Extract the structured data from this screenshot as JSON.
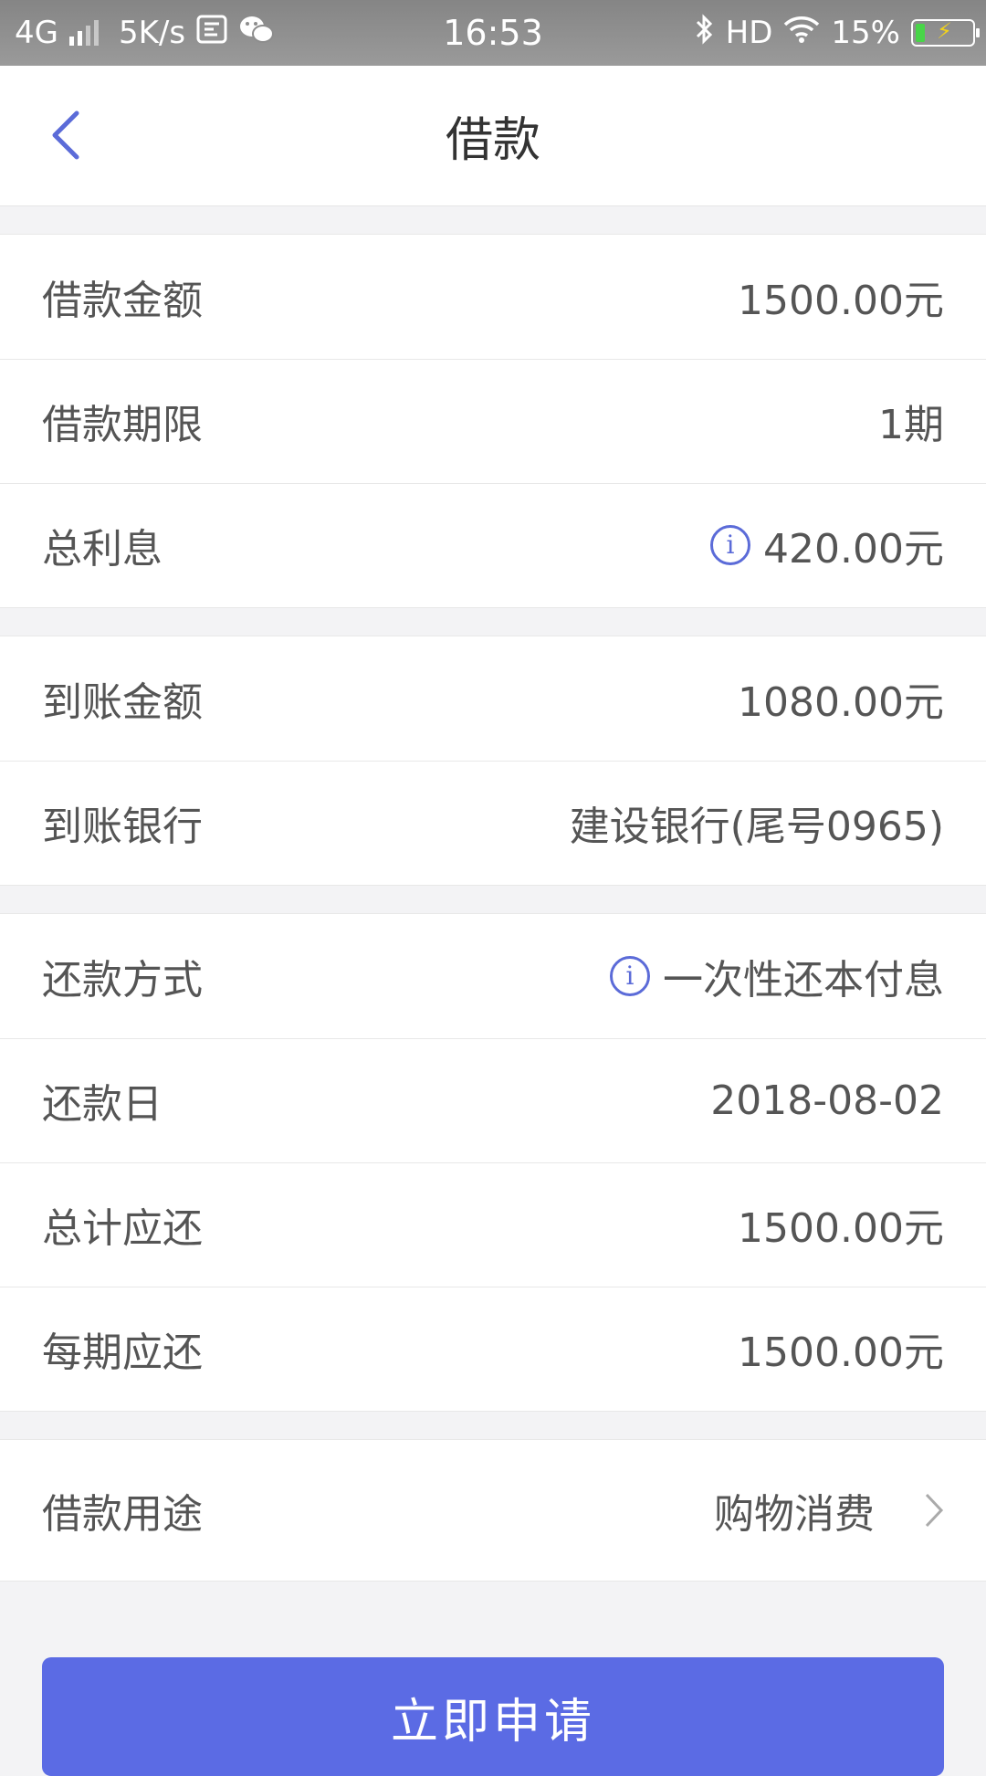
{
  "status_bar": {
    "network": "4G",
    "speed": "5K/s",
    "time": "16:53",
    "hd": "HD",
    "battery": "15%",
    "icons": [
      "signal-icon",
      "app-notification-icon",
      "wechat-icon",
      "bluetooth-icon",
      "wifi-icon",
      "battery-icon"
    ]
  },
  "header": {
    "title": "借款"
  },
  "groups": {
    "loan": {
      "amount_label": "借款金额",
      "amount_value": "1500.00元",
      "term_label": "借款期限",
      "term_value": "1期",
      "interest_label": "总利息",
      "interest_value": "420.00元"
    },
    "account": {
      "received_label": "到账金额",
      "received_value": "1080.00元",
      "bank_label": "到账银行",
      "bank_value": "建设银行(尾号0965)"
    },
    "repay": {
      "method_label": "还款方式",
      "method_value": "一次性还本付息",
      "date_label": "还款日",
      "date_value": "2018-08-02",
      "total_label": "总计应还",
      "total_value": "1500.00元",
      "per_label": "每期应还",
      "per_value": "1500.00元"
    },
    "purpose": {
      "label": "借款用途",
      "value": "购物消费"
    }
  },
  "actions": {
    "apply_label": "立即申请"
  },
  "colors": {
    "accent": "#5b6be4",
    "icon_blue": "#5b6bd8",
    "background": "#f3f3f5"
  }
}
